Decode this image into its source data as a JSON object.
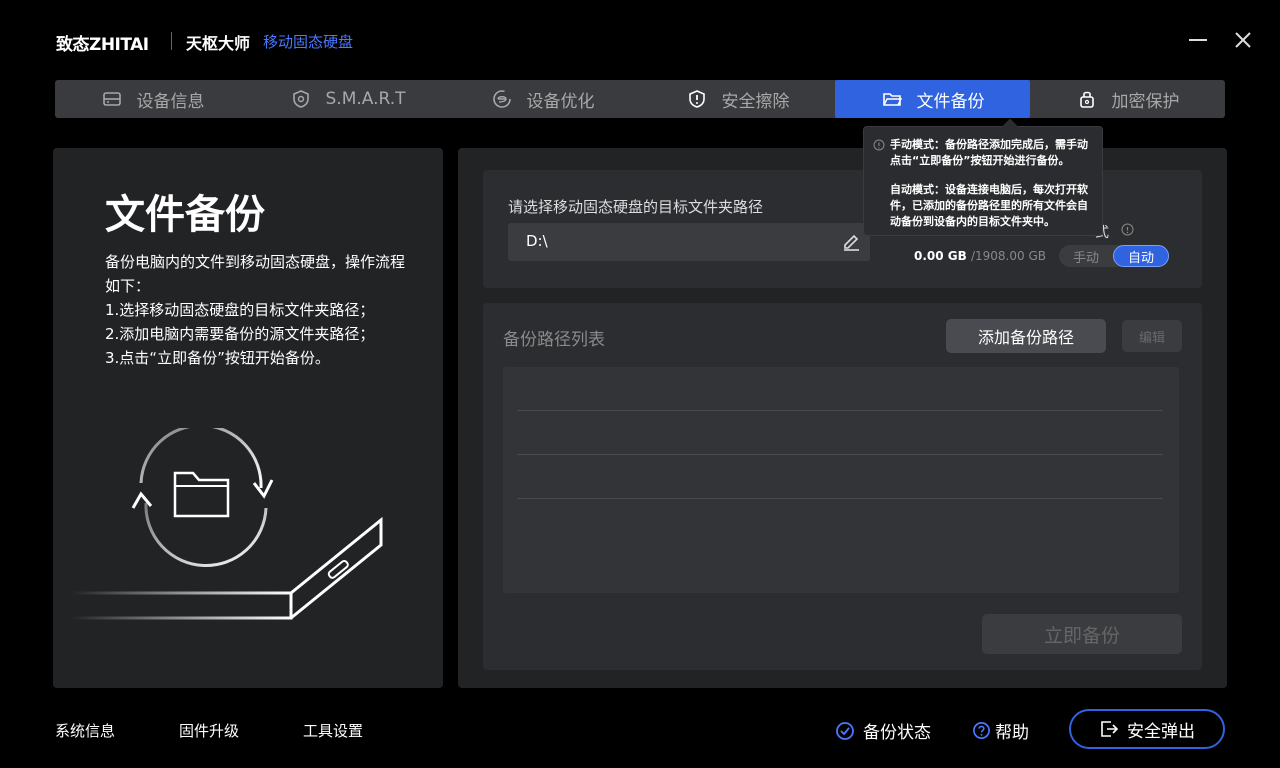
{
  "header": {
    "brand": "致态ZHITAI",
    "app_name": "天枢大师",
    "app_sub": "移动固态硬盘"
  },
  "tabs": [
    {
      "label": "设备信息",
      "icon": "drive-icon"
    },
    {
      "label": "S.M.A.R.T",
      "icon": "shield-icon"
    },
    {
      "label": "设备优化",
      "icon": "optimize-icon"
    },
    {
      "label": "安全擦除",
      "icon": "alert-shield-icon"
    },
    {
      "label": "文件备份",
      "icon": "folder-icon",
      "active": true
    },
    {
      "label": "加密保护",
      "icon": "lock-icon"
    }
  ],
  "left_panel": {
    "title": "文件备份",
    "desc": "备份电脑内的文件到移动固态硬盘，操作流程如下：",
    "steps": [
      "1.选择移动固态硬盘的目标文件夹路径；",
      "2.添加电脑内需要备份的源文件夹路径；",
      "3.点击“立即备份”按钮开始备份。"
    ]
  },
  "target": {
    "label": "请选择移动固态硬盘的目标文件夹路径",
    "path": "D:\\",
    "mode_label": "式",
    "used": "0.00 GB",
    "total": "/1908.00 GB",
    "mode_manual": "手动",
    "mode_auto": "自动"
  },
  "tooltip": {
    "manual": "手动模式：备份路径添加完成后，需手动点击“立即备份”按钮开始进行备份。",
    "auto": "自动模式：设备连接电脑后，每次打开软件，已添加的备份路径里的所有文件会自动备份到设备内的目标文件夹中。"
  },
  "backup_list": {
    "title": "备份路径列表",
    "add_label": "添加备份路径",
    "edit_label": "编辑",
    "backup_now": "立即备份"
  },
  "footer": {
    "system_info": "系统信息",
    "firmware": "固件升级",
    "settings": "工具设置",
    "backup_status": "备份状态",
    "help": "帮助",
    "eject": "安全弹出"
  },
  "colors": {
    "accent": "#2f63e0",
    "brand_sub": "#4a78ff",
    "background": "#000000",
    "panel": "#222325"
  }
}
